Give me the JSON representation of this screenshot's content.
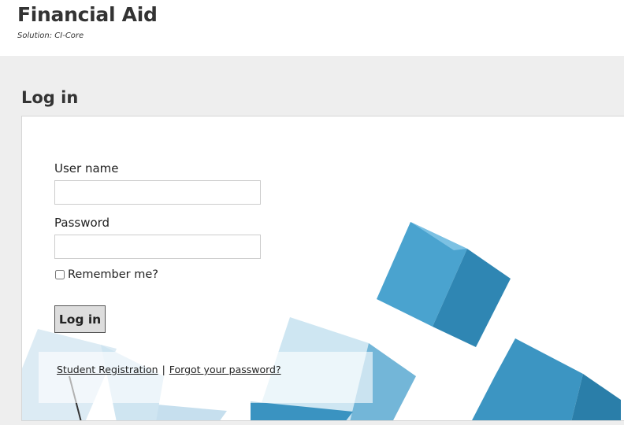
{
  "header": {
    "title": "Financial Aid",
    "subtitle": "Solution: CI-Core"
  },
  "login": {
    "title": "Log in",
    "username_label": "User name",
    "username_value": "",
    "password_label": "Password",
    "password_value": "",
    "remember_label": "Remember me?",
    "submit_label": "Log in",
    "links": {
      "register": "Student Registration",
      "separator": "|",
      "forgot": "Forgot your password?"
    }
  },
  "colors": {
    "page_bg": "#eeeeee",
    "panel_bg": "#ffffff",
    "cube_blue": "#3c95c2"
  }
}
